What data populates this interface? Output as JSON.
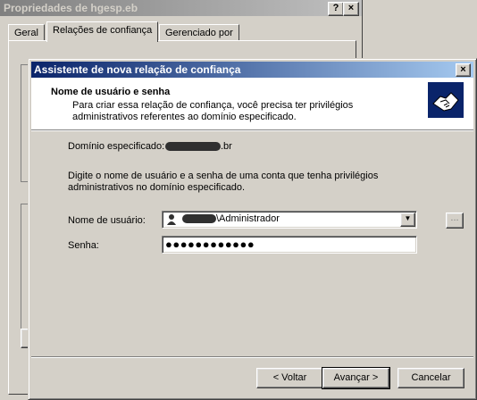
{
  "background_window": {
    "title": "Propriedades de hgesp.eb",
    "help_button": "?",
    "close_button": "×",
    "tabs": [
      {
        "label": "Geral"
      },
      {
        "label": "Relações de confiança"
      },
      {
        "label": "Gerenciado por"
      }
    ]
  },
  "wizard": {
    "title": "Assistente de nova relação de confiança",
    "close_button": "×",
    "header": {
      "title": "Nome de usuário e senha",
      "description": "Para criar essa relação de confiança, você precisa ter privilégios administrativos referentes ao domínio especificado."
    },
    "domain": {
      "label": "Domínio especificado:",
      "suffix": ".br"
    },
    "instructions": "Digite o nome de usuário e a senha de uma conta que tenha privilégios administrativos no domínio especificado.",
    "username": {
      "label": "Nome de usuário:",
      "value_suffix": "\\Administrador"
    },
    "password": {
      "label": "Senha:",
      "value": "●●●●●●●●●●●●"
    },
    "browse_button": "...",
    "buttons": {
      "back": "< Voltar",
      "next": "Avançar >",
      "cancel": "Cancelar"
    }
  },
  "colors": {
    "active_title_start": "#0a246a",
    "active_title_end": "#a6caf0",
    "inactive_title": "#808080",
    "face": "#d4d0c8"
  }
}
